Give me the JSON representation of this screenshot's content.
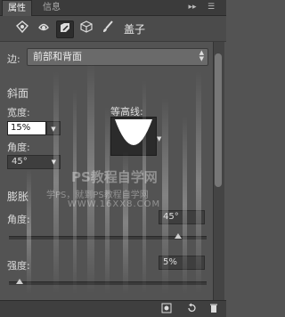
{
  "tabs": [
    {
      "label": "属性"
    },
    {
      "label": "信息"
    }
  ],
  "tabbar_buttons": {
    "expand": "▸▸",
    "menu": "☰"
  },
  "toolbar": {
    "tools": [
      {
        "icon": "layer-style-icon"
      },
      {
        "icon": "mask-icon"
      },
      {
        "icon": "bevel-icon"
      },
      {
        "icon": "3d-box-icon"
      },
      {
        "icon": "brush-icon"
      }
    ],
    "label": "盖子"
  },
  "edge": {
    "label": "边:",
    "value": "前部和背面"
  },
  "bevel": {
    "section_title": "斜面",
    "width_label": "宽度:",
    "width_value": "15%",
    "contour_label": "等高线:",
    "angle_label": "角度:",
    "angle_value": "45°"
  },
  "inflate": {
    "section_title": "膨胀",
    "angle_label": "角度:",
    "angle_value": "45°",
    "strength_label": "强度:",
    "strength_value": "5%"
  },
  "watermark": {
    "line1": "PS教程自学网",
    "line2": "学PS，就到PS教程自学网",
    "line3": "WWW.16XX8.COM"
  }
}
